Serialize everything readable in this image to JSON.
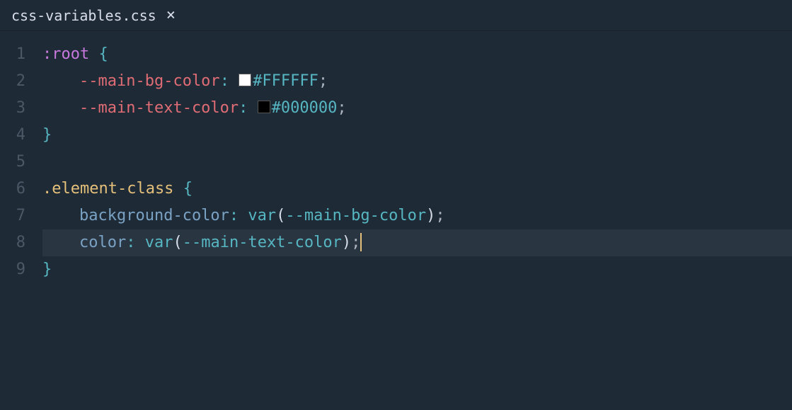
{
  "tab": {
    "filename": "css-variables.css",
    "close_glyph": "×"
  },
  "gutter": {
    "lines": [
      "1",
      "2",
      "3",
      "4",
      "5",
      "6",
      "7",
      "8",
      "9"
    ]
  },
  "code": {
    "line1": {
      "selector": ":root",
      "brace": "{"
    },
    "line2": {
      "prop": "--main-bg-color",
      "colon": ":",
      "swatch": "#FFFFFF",
      "value": "#FFFFFF",
      "semi": ";"
    },
    "line3": {
      "prop": "--main-text-color",
      "colon": ":",
      "swatch": "#000000",
      "value": "#000000",
      "semi": ";"
    },
    "line4": {
      "brace": "}"
    },
    "line6": {
      "selector": ".element-class",
      "brace": "{"
    },
    "line7": {
      "prop": "background-color",
      "colon": ":",
      "func": "var",
      "paren_open": "(",
      "varname": "--main-bg-color",
      "paren_close": ")",
      "semi": ";"
    },
    "line8": {
      "prop": "color",
      "colon": ":",
      "func": "var",
      "paren_open": "(",
      "varname": "--main-text-color",
      "paren_close": ")",
      "semi": ";"
    },
    "line9": {
      "brace": "}"
    }
  }
}
